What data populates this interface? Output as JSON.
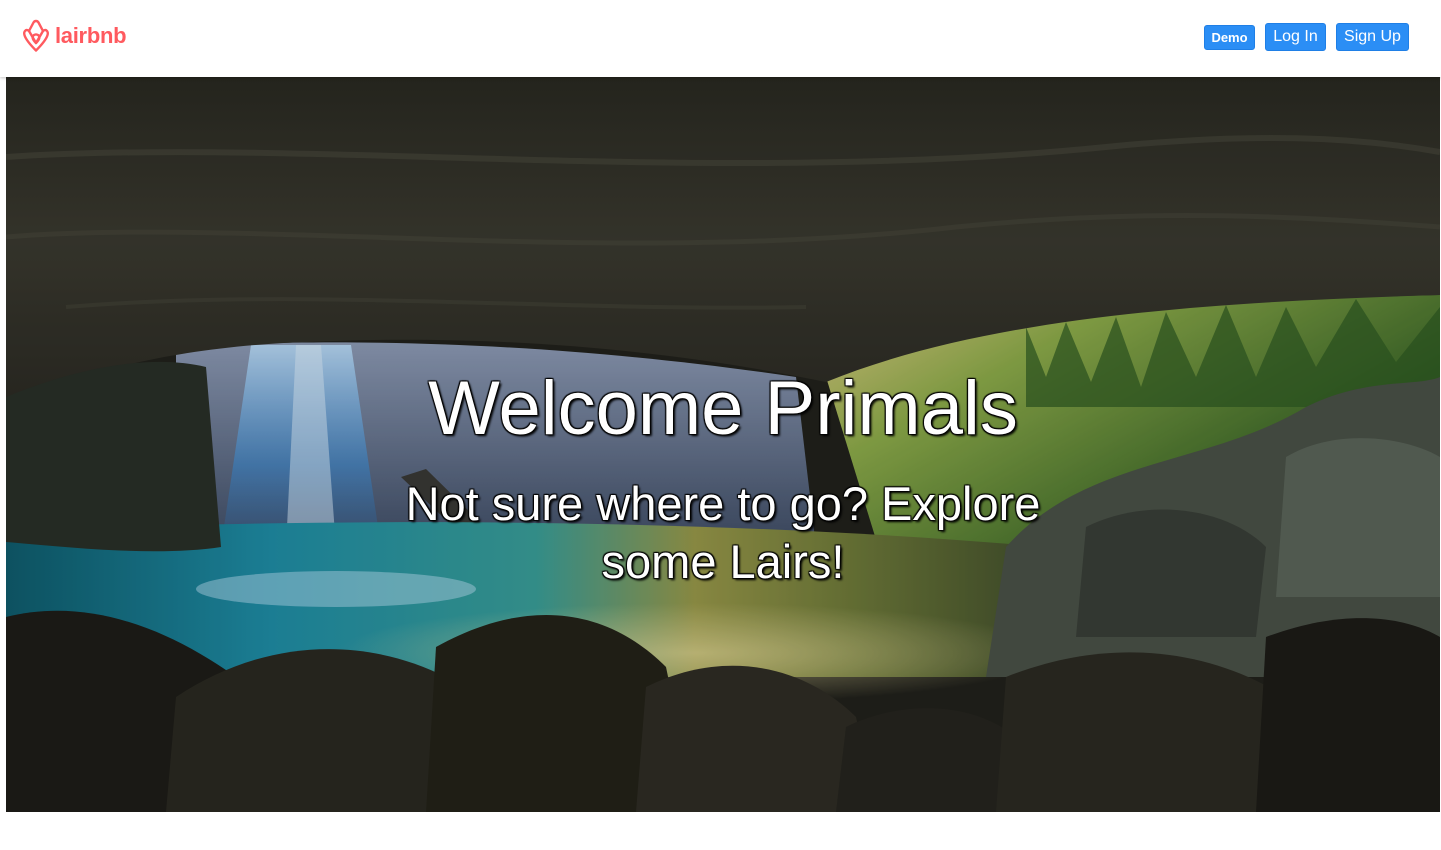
{
  "header": {
    "brand": "lairbnb",
    "brand_color": "#ff5a5f",
    "logo_icon": "airbnb-belo-icon",
    "buttons": {
      "demo": "Demo",
      "login": "Log In",
      "signup": "Sign Up"
    },
    "button_color": "#2b8ef5"
  },
  "hero": {
    "title": "Welcome Primals",
    "subtitle": "Not sure where to go? Explore some Lairs!",
    "background": "cave-waterfall-photo"
  }
}
